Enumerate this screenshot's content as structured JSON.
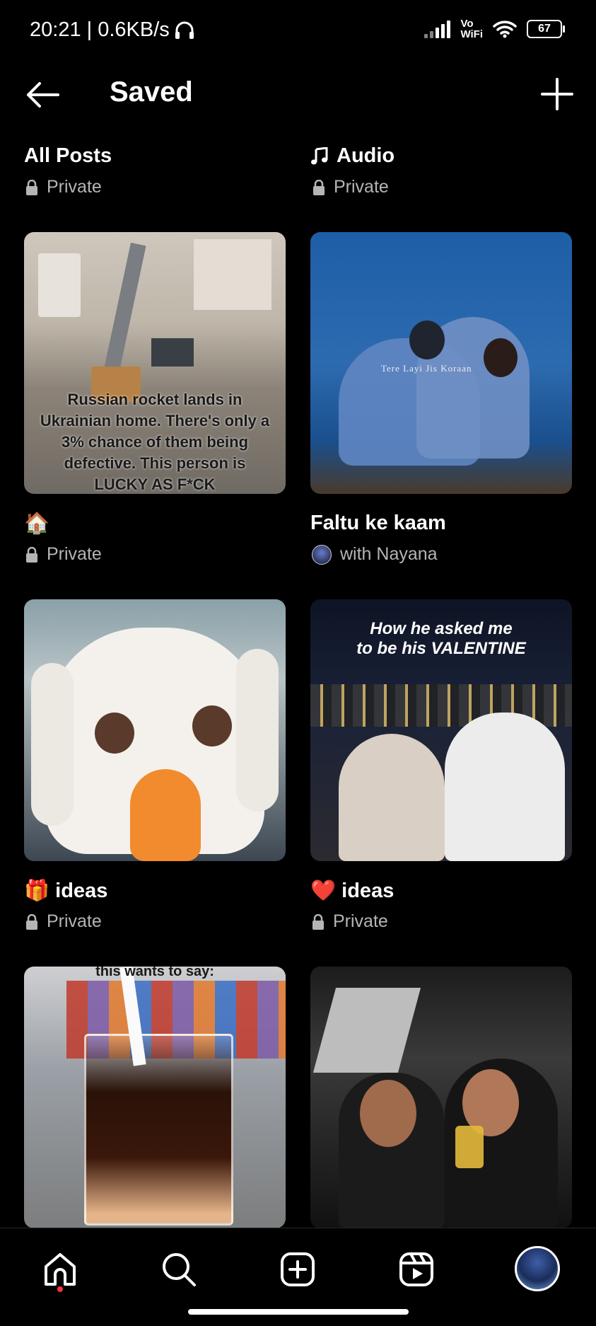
{
  "status_bar": {
    "time_speed": "20:21 | 0.6KB/s",
    "vowifi_top": "Vo",
    "vowifi_bottom": "WiFi",
    "battery": "67"
  },
  "header": {
    "title": "Saved"
  },
  "collections": [
    {
      "title": "All Posts",
      "privacy": "Private",
      "icon": ""
    },
    {
      "title": "Audio",
      "privacy": "Private",
      "icon": "music-note-icon"
    },
    {
      "title": "🏠",
      "privacy": "Private",
      "thumbnail_caption": "Russian rocket lands in Ukrainian home. There's only a 3% chance of them being defective. This person is LUCKY AS F*CK"
    },
    {
      "title": "Faltu ke kaam",
      "privacy": "with Nayana",
      "thumbnail_caption": "Tere Layi Jis Koraan"
    },
    {
      "title": "🎁 ideas",
      "privacy": "Private"
    },
    {
      "title": "❤️ ideas",
      "privacy": "Private",
      "thumbnail_caption_line1": "How he asked me",
      "thumbnail_caption_line2": "to be his VALENTINE"
    },
    {
      "title": "",
      "privacy": "",
      "thumbnail_caption": "this wants to say:"
    },
    {
      "title": "",
      "privacy": ""
    }
  ],
  "bottom_nav": {
    "items": [
      "home-icon",
      "search-icon",
      "create-icon",
      "reels-icon",
      "profile-avatar"
    ]
  },
  "colors": {
    "background": "#000000",
    "secondary_text": "#b5b5b5",
    "notification_dot": "#ff3040"
  }
}
